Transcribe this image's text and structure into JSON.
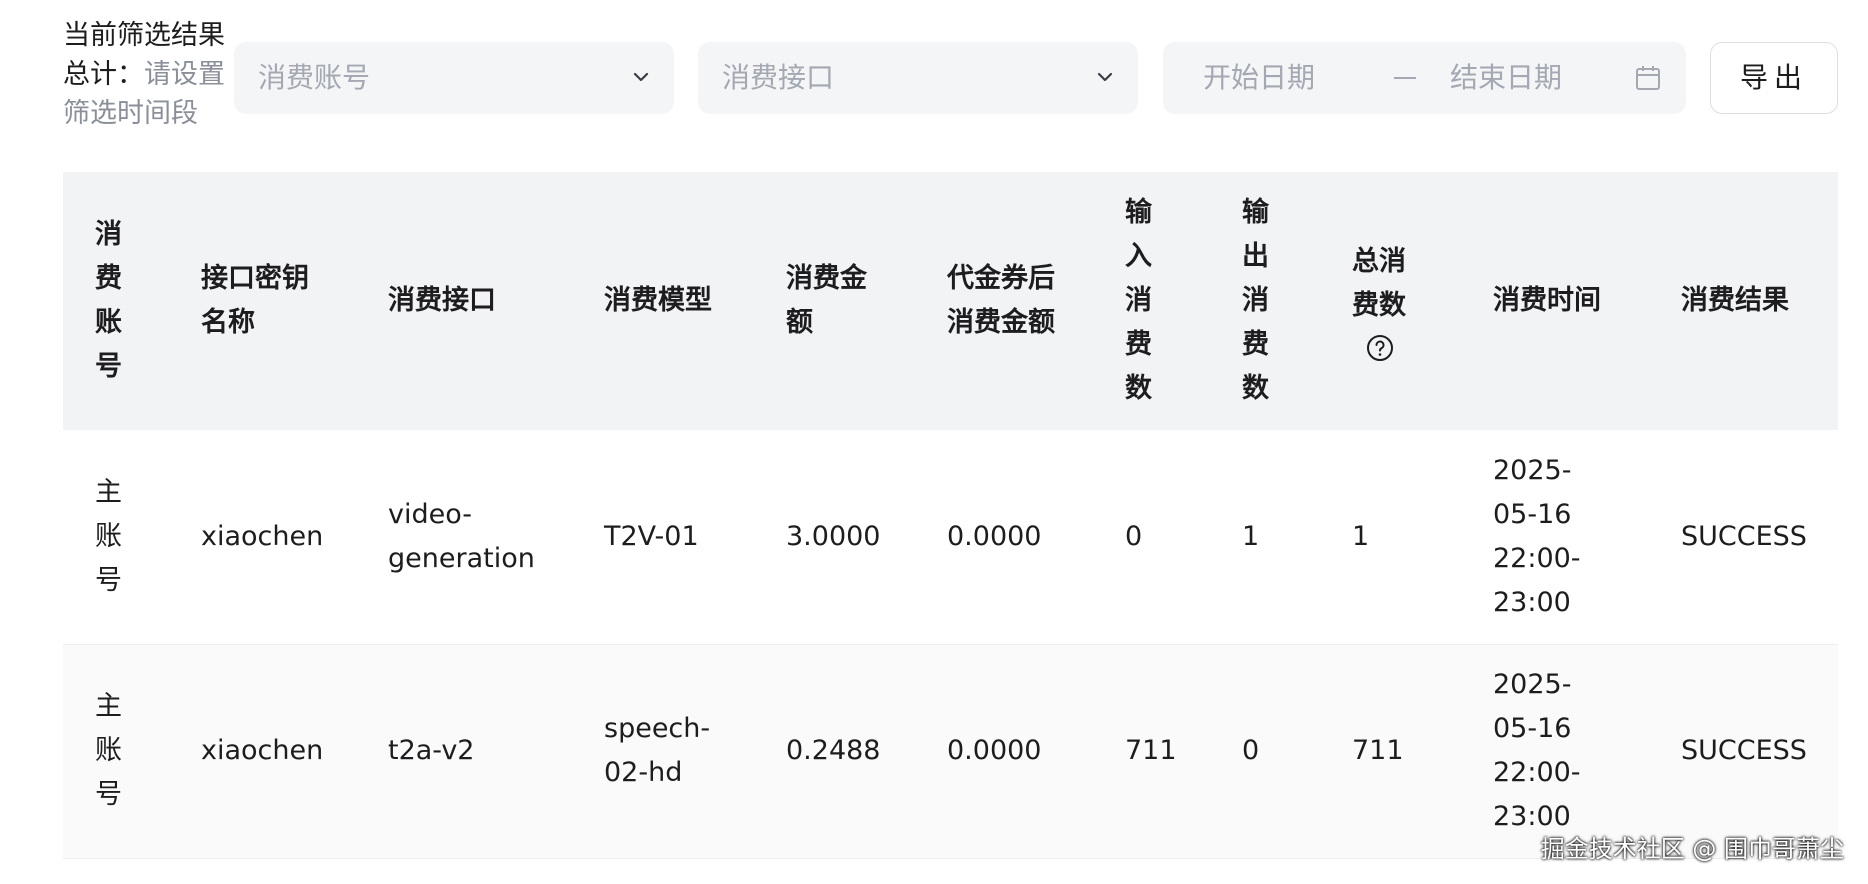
{
  "filter_summary": {
    "title": "当前筛选结果",
    "total_label": "总计：",
    "total_placeholder": "请设置",
    "total_placeholder_2": "筛选时间段"
  },
  "filters": {
    "account_placeholder": "消费账号",
    "api_placeholder": "消费接口",
    "start_date_placeholder": "开始日期",
    "end_date_placeholder": "结束日期",
    "export_label": "导出"
  },
  "table": {
    "columns": [
      [
        "消",
        "费",
        "账",
        "号"
      ],
      [
        "接口密钥",
        "名称"
      ],
      [
        "消费接口"
      ],
      [
        "消费模型"
      ],
      [
        "消费金",
        "额"
      ],
      [
        "代金券后",
        "消费金额"
      ],
      [
        "输",
        "入",
        "消",
        "费",
        "数"
      ],
      [
        "输",
        "出",
        "消",
        "费",
        "数"
      ],
      [
        "总消",
        "费数"
      ],
      [
        "消费时间"
      ],
      [
        "消费结果"
      ]
    ],
    "rows": [
      {
        "account": [
          "主",
          "账",
          "号"
        ],
        "key_name": "xiaochen",
        "api": [
          "video-",
          "generation"
        ],
        "model": [
          "T2V-01"
        ],
        "amount": "3.0000",
        "voucher_amount": "0.0000",
        "input_count": "0",
        "output_count": "1",
        "total_count": "1",
        "time": [
          "2025-",
          "05-16",
          "22:00-",
          "23:00"
        ],
        "result": "SUCCESS"
      },
      {
        "account": [
          "主",
          "账",
          "号"
        ],
        "key_name": "xiaochen",
        "api": [
          "t2a-v2"
        ],
        "model": [
          "speech-",
          "02-hd"
        ],
        "amount": "0.2488",
        "voucher_amount": "0.0000",
        "input_count": "711",
        "output_count": "0",
        "total_count": "711",
        "time": [
          "2025-",
          "05-16",
          "22:00-",
          "23:00"
        ],
        "result": "SUCCESS"
      }
    ]
  },
  "icons": {
    "dropdown": "chevron-down-icon",
    "calendar": "calendar-icon",
    "help": "question-circle-icon"
  },
  "watermark": "掘金技术社区 @ 围巾哥萧尘"
}
